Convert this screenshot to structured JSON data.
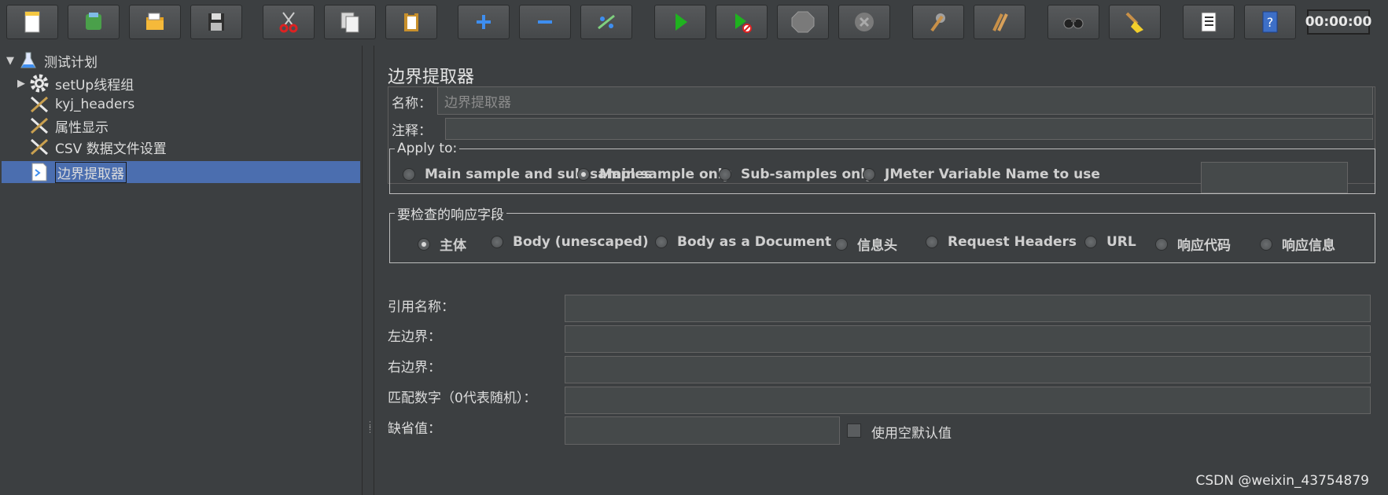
{
  "toolbar": {
    "buttons": [
      {
        "name": "new-button",
        "icon": "new-file-icon"
      },
      {
        "name": "templates-button",
        "icon": "templates-icon"
      },
      {
        "name": "open-button",
        "icon": "open-folder-icon"
      },
      {
        "name": "save-button",
        "icon": "save-icon"
      },
      {
        "name": "cut-button",
        "icon": "scissors-icon"
      },
      {
        "name": "copy-button",
        "icon": "copy-icon"
      },
      {
        "name": "paste-button",
        "icon": "paste-icon"
      },
      {
        "name": "expand-button",
        "icon": "plus-icon"
      },
      {
        "name": "collapse-button",
        "icon": "minus-icon"
      },
      {
        "name": "toggle-button",
        "icon": "toggle-icon"
      },
      {
        "name": "start-button",
        "icon": "play-icon"
      },
      {
        "name": "start-no-pauses-button",
        "icon": "play-no-timer-icon"
      },
      {
        "name": "stop-button",
        "icon": "stop-icon"
      },
      {
        "name": "shutdown-button",
        "icon": "shutdown-icon"
      },
      {
        "name": "clear-button",
        "icon": "broom-gear-icon"
      },
      {
        "name": "clear-all-button",
        "icon": "broom-all-icon"
      },
      {
        "name": "search-button",
        "icon": "binoculars-icon"
      },
      {
        "name": "reset-search-button",
        "icon": "broom-icon"
      },
      {
        "name": "function-helper-button",
        "icon": "list-icon"
      },
      {
        "name": "help-button",
        "icon": "help-book-icon"
      }
    ],
    "timer": "00:00:00"
  },
  "tree": {
    "items": [
      {
        "label": "测试计划",
        "icon": "test-plan-flask-icon",
        "expanded": true
      },
      {
        "label": "setUp线程组",
        "icon": "gear-icon",
        "expanded": false
      },
      {
        "label": "kyj_headers",
        "icon": "wrench-icon"
      },
      {
        "label": "属性显示",
        "icon": "wrench-icon"
      },
      {
        "label": "CSV 数据文件设置",
        "icon": "wrench-icon"
      },
      {
        "label": "边界提取器",
        "icon": "extractor-icon",
        "selected": true
      }
    ]
  },
  "editor": {
    "title": "边界提取器",
    "name_label": "名称：",
    "name_value": "边界提取器",
    "comment_label": "注释：",
    "comment_value": "",
    "apply_to": {
      "legend": "Apply to:",
      "options": [
        "Main sample and sub-samples",
        "Main sample only",
        "Sub-samples only",
        "JMeter Variable Name to use"
      ],
      "selected": "Main sample only",
      "variable_value": ""
    },
    "field_to_check": {
      "legend": "要检查的响应字段",
      "options": [
        "主体",
        "Body (unescaped)",
        "Body as a Document",
        "信息头",
        "Request Headers",
        "URL",
        "响应代码",
        "响应信息"
      ],
      "selected": "主体"
    },
    "ref_name_label": "引用名称：",
    "left_boundary_label": "左边界：",
    "right_boundary_label": "右边界：",
    "match_no_label": "匹配数字（0代表随机）：",
    "default_label": "缺省值：",
    "use_empty_default_label": "使用空默认值",
    "use_empty_default_checked": false
  },
  "watermark": "CSDN @weixin_43754879",
  "colors": {
    "background": "#3c3f41",
    "selection": "#4b6eaf",
    "field": "#45494a"
  }
}
